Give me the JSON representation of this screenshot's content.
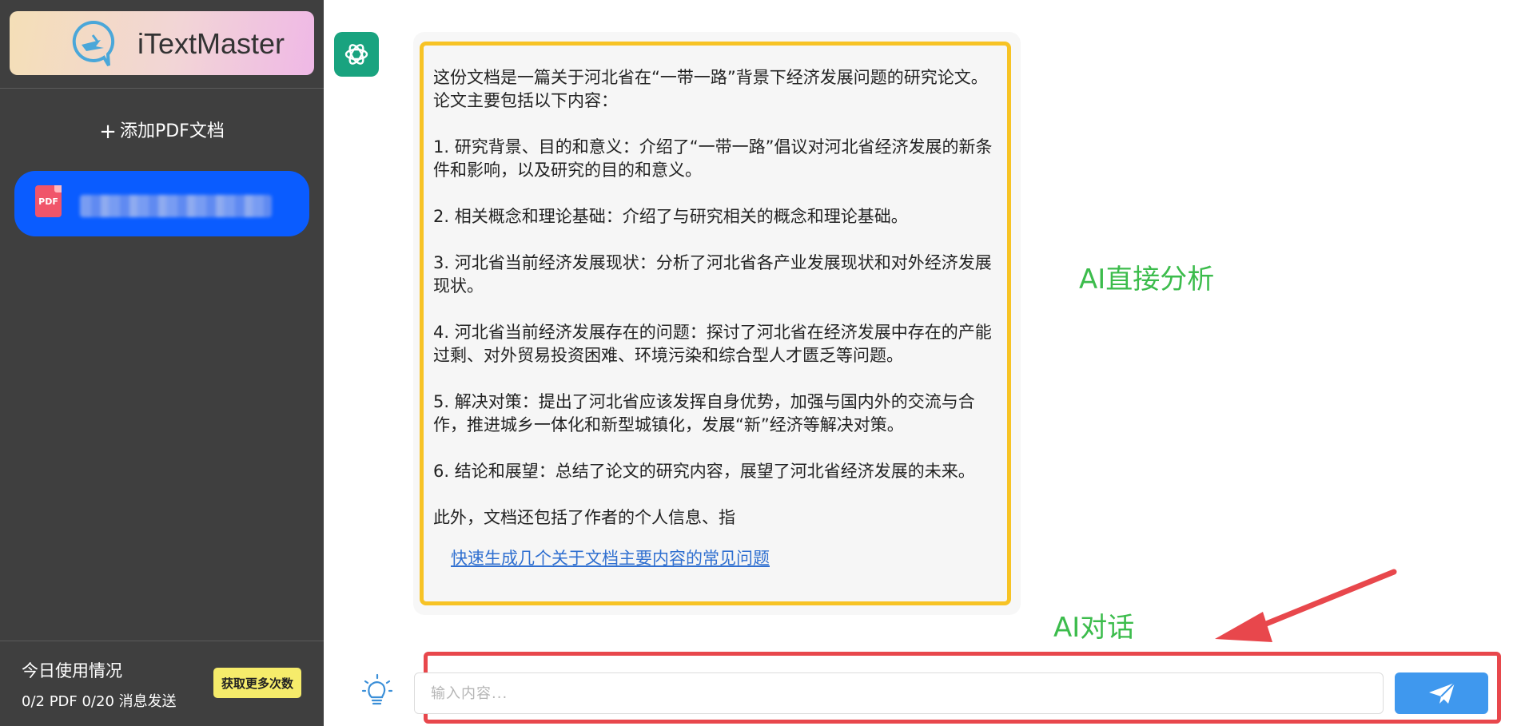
{
  "app": {
    "title": "iTextMaster"
  },
  "sidebar": {
    "add_pdf_label": "添加PDF文档",
    "document": {
      "icon_label": "PDF"
    },
    "usage": {
      "title": "今日使用情况",
      "stats": "0/2 PDF  0/20 消息发送",
      "get_more_label": "获取更多次数"
    }
  },
  "chat": {
    "message": {
      "paragraphs": [
        "这份文档是一篇关于河北省在“一带一路”背景下经济发展问题的研究论文。论文主要包括以下内容：",
        "1. 研究背景、目的和意义：介绍了“一带一路”倡议对河北省经济发展的新条件和影响，以及研究的目的和意义。",
        "2. 相关概念和理论基础：介绍了与研究相关的概念和理论基础。",
        "3. 河北省当前经济发展现状：分析了河北省各产业发展现状和对外经济发展现状。",
        "4. 河北省当前经济发展存在的问题：探讨了河北省在经济发展中存在的产能过剩、对外贸易投资困难、环境污染和综合型人才匮乏等问题。",
        "5. 解决对策：提出了河北省应该发挥自身优势，加强与国内外的交流与合作，推进城乡一体化和新型城镇化，发展“新”经济等解决对策。",
        "6. 结论和展望：总结了论文的研究内容，展望了河北省经济发展的未来。",
        "此外，文档还包括了作者的个人信息、指"
      ],
      "quick_question_link": "快速生成几个关于文档主要内容的常见问题"
    },
    "annotations": {
      "ai_analysis": "AI直接分析",
      "ai_chat": "AI对话"
    },
    "input": {
      "placeholder": "输入内容...",
      "value": ""
    }
  },
  "colors": {
    "sidebar_bg": "#3f3f3f",
    "doc_item_bg": "#0a5cff",
    "highlight_yellow": "#f7c325",
    "annotation_green": "#3cbc4c",
    "annotation_red": "#e8474c",
    "send_button": "#3f98ee",
    "bot_avatar": "#19a37f"
  },
  "icons": [
    "logo-icon",
    "plus-icon",
    "pdf-icon",
    "chatgpt-icon",
    "lightbulb-icon",
    "send-icon",
    "arrow-annotation"
  ]
}
